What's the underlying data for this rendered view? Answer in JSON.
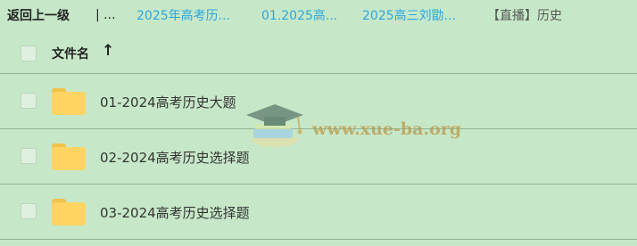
{
  "breadcrumb": {
    "back_label": "返回上一级",
    "separator": "| ...",
    "items": [
      {
        "label": "2025年高考历..."
      },
      {
        "label": "01.2025高..."
      },
      {
        "label": "2025高三刘勖..."
      }
    ],
    "current": "【直播】历史"
  },
  "table": {
    "header": {
      "column_name": "文件名",
      "sort_icon": "arrow-up-icon",
      "sort_symbol": "↑"
    },
    "rows": [
      {
        "name": "01-2024高考历史大题",
        "icon": "folder-icon"
      },
      {
        "name": "02-2024高考历史选择题",
        "icon": "folder-icon"
      },
      {
        "name": "03-2024高考历史选择题",
        "icon": "folder-icon"
      }
    ]
  },
  "watermark": {
    "text": "www.xue-ba.org",
    "icon": "graduation-cap-icon"
  },
  "colors": {
    "background": "#c7e8c8",
    "link": "#2aa6e0",
    "folder": "#ffd463",
    "divider": "#8fb591"
  }
}
